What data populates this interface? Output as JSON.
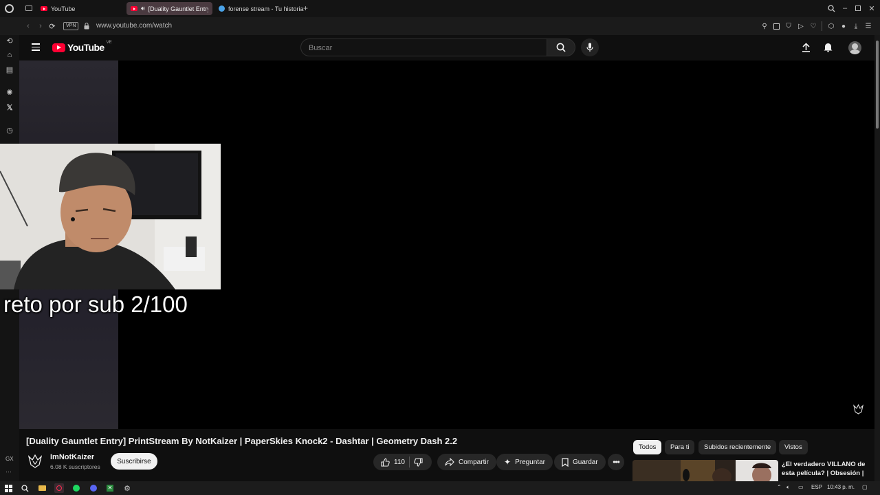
{
  "browser": {
    "tabs": [
      {
        "label": "YouTube",
        "icon": "youtube-icon"
      },
      {
        "label": "[Duality Gauntlet Entry]",
        "icon": "youtube-icon",
        "active": true
      },
      {
        "label": "forense stream - Tu historia",
        "icon": "globe-icon"
      }
    ],
    "url": "www.youtube.com/watch",
    "vpn_label": "VPN",
    "sidebar_label": "GX"
  },
  "youtube": {
    "logo_text": "YouTube",
    "country_code": "VE",
    "search_placeholder": "Buscar"
  },
  "video": {
    "caption": "reto por sub 2/100",
    "title": "[Duality Gauntlet Entry] PrintStream By NotKaizer | PaperSkies Knock2 - Dashtar | Geometry Dash 2.2",
    "channel_name": "ImNotKaizer",
    "subscribers": "6.08 K suscriptores",
    "subscribe_label": "Suscribirse",
    "likes": "110",
    "share_label": "Compartir",
    "ask_label": "Preguntar",
    "save_label": "Guardar"
  },
  "recommendations": {
    "chips": [
      "Todos",
      "Para ti",
      "Subidos recientemente",
      "Vistos"
    ],
    "first_title": "¿El verdadero VILLANO de esta película? | Obsesión |"
  },
  "taskbar": {
    "language": "ESP",
    "time": "10:43 p. m."
  },
  "colors": {
    "youtube_red": "#ff0033",
    "background": "#0f0f0f",
    "chip_selected": "#f1f1f1"
  }
}
